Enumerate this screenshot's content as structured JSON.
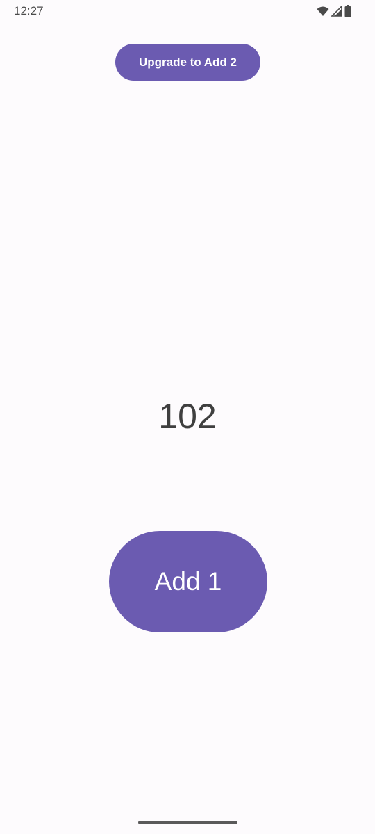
{
  "status_bar": {
    "time": "12:27",
    "icons": [
      "wifi-icon",
      "signal-icon",
      "battery-icon"
    ]
  },
  "upgrade_button": {
    "label": "Upgrade to Add 2"
  },
  "counter": {
    "value": "102"
  },
  "add_button": {
    "label": "Add 1"
  },
  "colors": {
    "accent": "#6b5bb1",
    "background": "#fdfbfd",
    "text": "#3f3f3f"
  }
}
